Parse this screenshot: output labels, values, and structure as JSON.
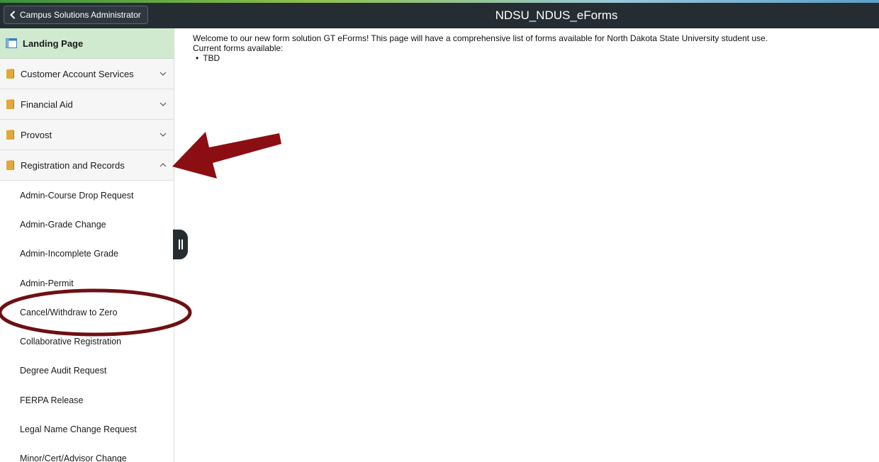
{
  "header": {
    "back_label": "Campus Solutions Administrator",
    "title": "NDSU_NDUS_eForms"
  },
  "sidebar": {
    "landing_label": "Landing Page",
    "categories": [
      {
        "label": "Customer Account Services",
        "expanded": false
      },
      {
        "label": "Financial Aid",
        "expanded": false
      },
      {
        "label": "Provost",
        "expanded": false
      },
      {
        "label": "Registration and Records",
        "expanded": true
      }
    ],
    "sub_items": [
      "Admin-Course Drop Request",
      "Admin-Grade Change",
      "Admin-Incomplete Grade",
      "Admin-Permit",
      "Cancel/Withdraw to Zero",
      "Collaborative Registration",
      "Degree Audit Request",
      "FERPA Release",
      "Legal Name Change Request",
      "Minor/Cert/Advisor Change"
    ]
  },
  "content": {
    "welcome": "Welcome to our new form solution GT eForms! This page will have a comprehensive list of forms available for North Dakota State University student use.",
    "current_label": "Current forms available:",
    "forms": [
      "TBD"
    ]
  },
  "colors": {
    "header_bg": "#252d33",
    "landing_bg": "#d0eacf",
    "folder_icon": "#e3a83a",
    "annotation": "#8b0f12"
  },
  "icons": {
    "back": "chevron-left-icon",
    "landing": "landing-page-icon",
    "folder": "folder-icon",
    "chevron_down": "chevron-down-icon",
    "chevron_up": "chevron-up-icon",
    "collapse": "collapse-handle-icon"
  }
}
